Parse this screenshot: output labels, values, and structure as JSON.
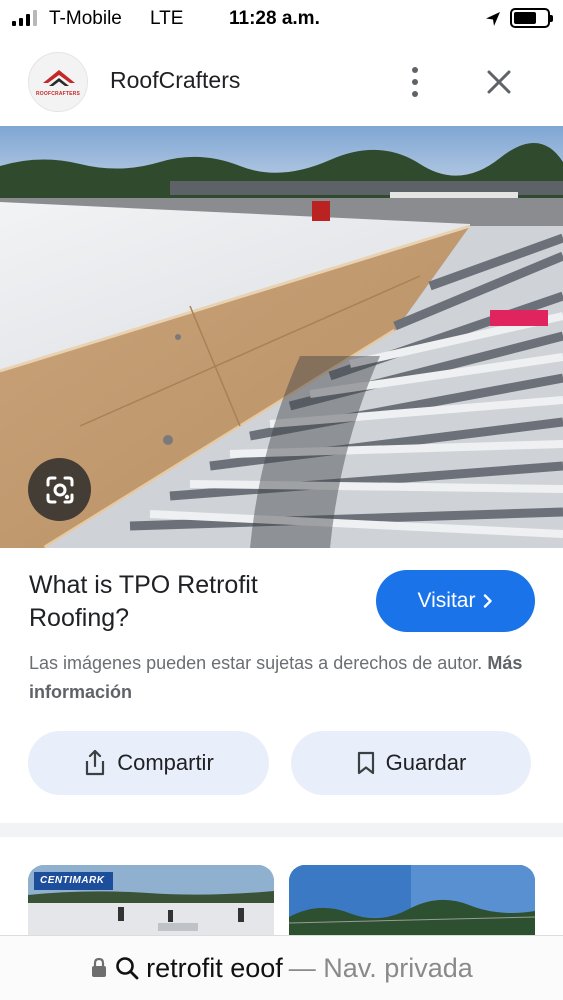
{
  "status_bar": {
    "carrier": "T-Mobile",
    "network": "LTE",
    "time": "11:28 a.m.",
    "battery_level": 0.7,
    "icons": [
      "signal-icon",
      "location-icon",
      "battery-icon"
    ]
  },
  "header": {
    "logo_text": "ROOFCRAFTERS",
    "site_name": "RoofCrafters",
    "icons": [
      "more-vert-icon",
      "close-icon"
    ]
  },
  "hero": {
    "lens_icon": "lens-icon"
  },
  "result": {
    "title": "What is TPO Retrofit Roofing?",
    "visit_label": "Visitar",
    "copyright_text": "Las imágenes pueden estar sujetas a derechos de autor.",
    "more_info_label": "Más información"
  },
  "actions": {
    "share_label": "Compartir",
    "save_label": "Guardar",
    "icons": [
      "share-icon",
      "bookmark-icon"
    ]
  },
  "related": {
    "thumb_1_badge": "CENTIMARK"
  },
  "address_bar": {
    "query": "retrofit eoof",
    "mode": "— Nav. privada",
    "icons": [
      "lock-icon",
      "search-icon"
    ]
  },
  "colors": {
    "accent": "#1a73e8",
    "pill_bg": "#e8effa",
    "text": "#202124",
    "muted": "#6b6e72"
  }
}
